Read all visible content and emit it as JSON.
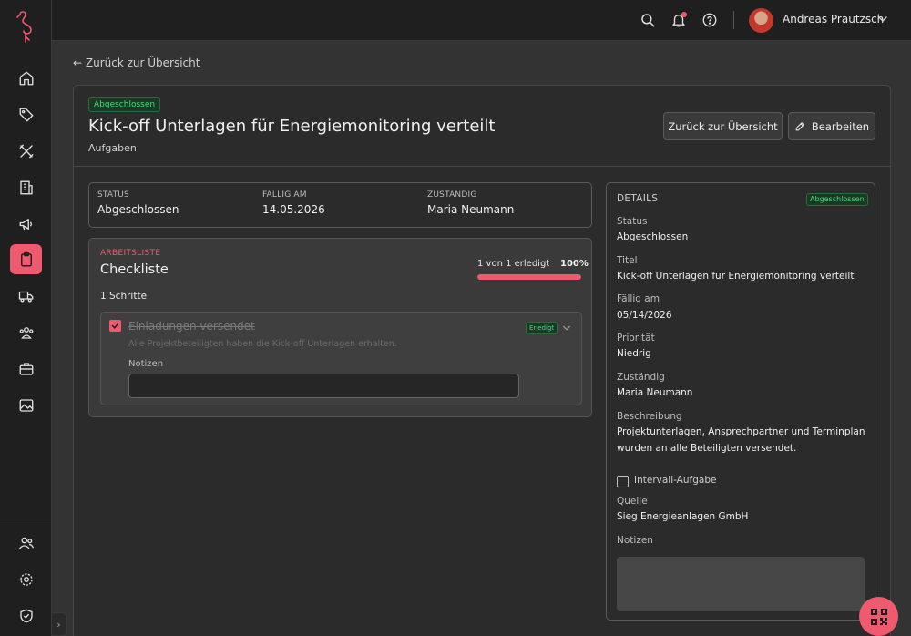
{
  "sidebar": {
    "logo": "flamingo-logo",
    "items": [
      {
        "name": "home",
        "icon": "home-icon"
      },
      {
        "name": "tags",
        "icon": "tag-icon"
      },
      {
        "name": "tools",
        "icon": "tools-icon"
      },
      {
        "name": "buildings",
        "icon": "building-icon"
      },
      {
        "name": "campaigns",
        "icon": "megaphone-icon"
      },
      {
        "name": "tasks",
        "icon": "clipboard-icon",
        "active": true
      },
      {
        "name": "delivery",
        "icon": "truck-icon"
      },
      {
        "name": "contacts",
        "icon": "people-icon"
      },
      {
        "name": "jobs",
        "icon": "briefcase-icon"
      },
      {
        "name": "gallery",
        "icon": "image-icon"
      }
    ],
    "bottom_items": [
      {
        "name": "users",
        "icon": "users-icon"
      },
      {
        "name": "settings",
        "icon": "gear-icon"
      },
      {
        "name": "security",
        "icon": "shield-check-icon"
      }
    ],
    "collapse_glyph": "›"
  },
  "topbar": {
    "user_name": "Andreas Prautzsch",
    "icons": [
      "search-icon",
      "bell-icon",
      "help-icon"
    ]
  },
  "back_link": "← Zurück zur Übersicht",
  "header": {
    "status_badge": "Abgeschlossen",
    "title": "Kick-off Unterlagen für Energiemonitoring verteilt",
    "subtitle": "Aufgaben",
    "back_button": "Zurück zur Übersicht",
    "edit_button": "Bearbeiten"
  },
  "summary": {
    "status_label": "STATUS",
    "status_value": "Abgeschlossen",
    "due_label": "FÄLLIG AM",
    "due_value": "14.05.2026",
    "assignee_label": "ZUSTÄNDIG",
    "assignee_value": "Maria Neumann"
  },
  "checklist": {
    "kicker": "ARBEITSLISTE",
    "title": "Checkliste",
    "progress_text": "1 von 1 erledigt",
    "progress_pct": "100%",
    "progress_value": 1.0,
    "steps_count": "1 Schritte",
    "step": {
      "title": "Einladungen versendet",
      "description": "Alle Projektbeteiligten haben die Kick-off Unterlagen erhalten.",
      "badge": "Erledigt",
      "notes_label": "Notizen",
      "notes_value": ""
    }
  },
  "details": {
    "title": "DETAILS",
    "badge": "Abgeschlossen",
    "status_label": "Status",
    "status_value": "Abgeschlossen",
    "title_label": "Titel",
    "title_value": "Kick-off Unterlagen für Energiemonitoring verteilt",
    "due_label": "Fällig am",
    "due_value": "05/14/2026",
    "priority_label": "Priorität",
    "priority_value": "Niedrig",
    "assignee_label": "Zuständig",
    "assignee_value": "Maria Neumann",
    "description_label": "Beschreibung",
    "description_value": "Projektunterlagen, Ansprechpartner und Terminplan wurden an alle Beteiligten versendet.",
    "interval_label": "Intervall-Aufgabe",
    "source_label": "Quelle",
    "source_value": "Sieg Energieanlagen GmbH",
    "notes_label": "Notizen"
  },
  "colors": {
    "accent": "#f05a6e",
    "success": "#4cd97b",
    "background": "#333333",
    "sidebar": "#1f1f1f"
  }
}
